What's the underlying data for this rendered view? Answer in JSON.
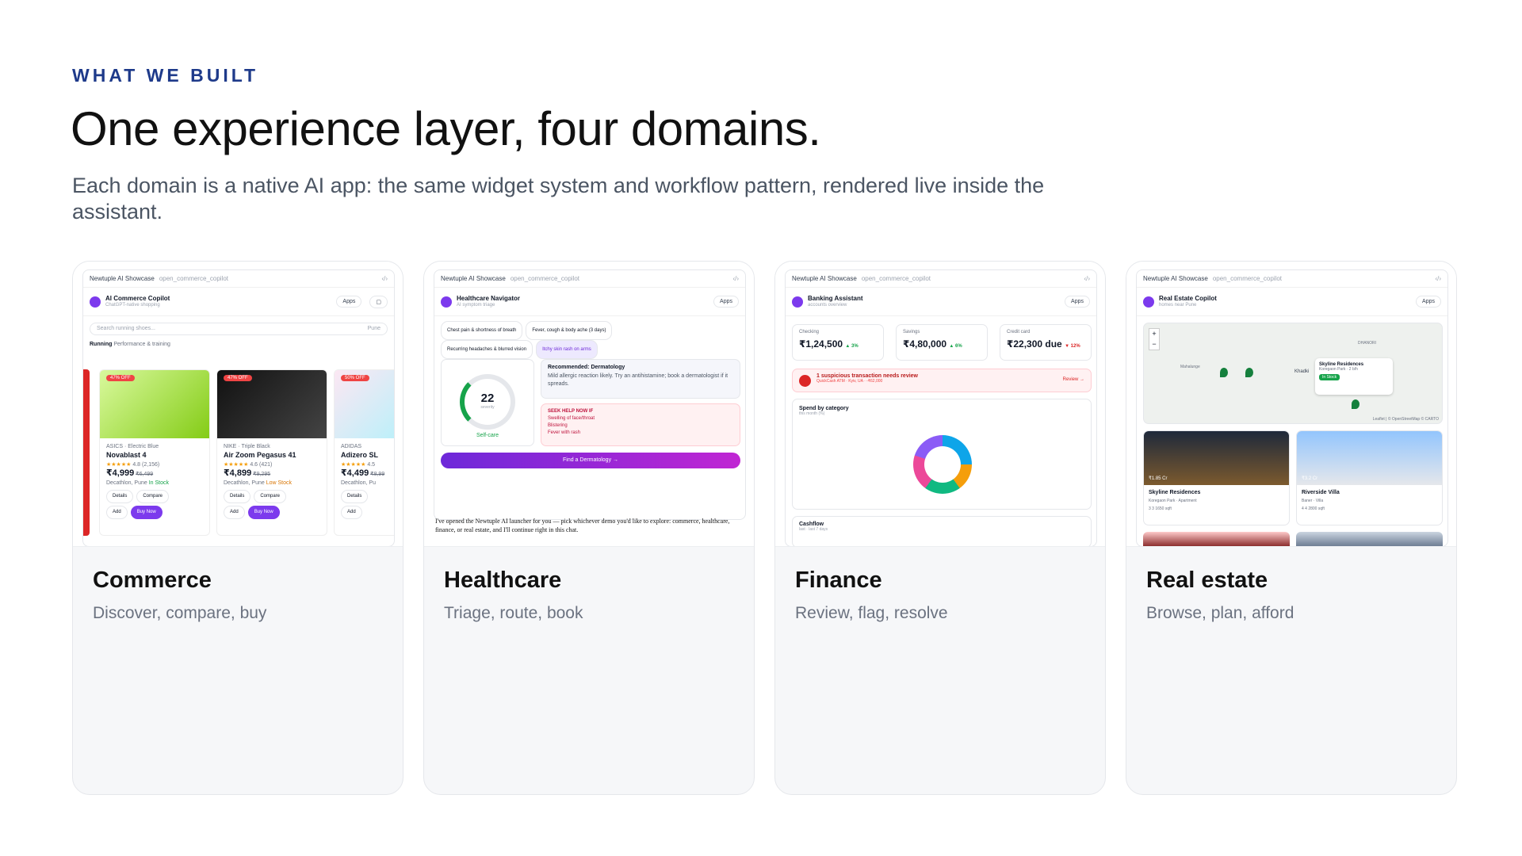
{
  "header": {
    "eyebrow": "WHAT WE BUILT",
    "title": "One experience layer, four domains.",
    "subtitle": "Each domain is a native AI app: the same widget system and workflow pattern, rendered live inside the assistant."
  },
  "colors": {
    "accent": "#1e3a8a",
    "brand": "#7c3aed",
    "card_bg": "#f6f7f9"
  },
  "cards": [
    {
      "title": "Commerce",
      "subtitle": "Discover, compare, buy",
      "screenshot": {
        "topbar": "Newtuple AI Showcase",
        "topbar_muted": "open_commerce_copilot",
        "app_name": "AI Commerce Copilot",
        "app_sub": "ChatGPT-native shopping",
        "apps_label": "Apps",
        "search_placeholder": "Search running shoes...",
        "location": "Pune",
        "section": "Running",
        "section_sub": "Performance & training",
        "products": [
          {
            "tag": "47% OFF",
            "brand": "ASICS",
            "variant": "Electric Blue",
            "name": "Novablast 4",
            "rating": "4.8 (2,156)",
            "price": "₹4,999",
            "old": "₹6,499",
            "store": "Decathlon, Pune",
            "stock": "In Stock"
          },
          {
            "tag": "47% OFF",
            "brand": "NIKE",
            "variant": "Triple Black",
            "name": "Air Zoom Pegasus 41",
            "rating": "4.6 (421)",
            "price": "₹4,899",
            "old": "₹9,295",
            "store": "Decathlon, Pune",
            "stock": "Low Stock"
          },
          {
            "tag": "50% OFF",
            "brand": "ADIDAS",
            "variant": "",
            "name": "Adizero SL",
            "rating": "4.5",
            "price": "₹4,499",
            "old": "₹8,99",
            "store": "Decathlon, Pu",
            "stock": ""
          }
        ],
        "btn_details": "Details",
        "btn_compare": "Compare",
        "btn_add": "Add",
        "btn_buy": "Buy Now"
      }
    },
    {
      "title": "Healthcare",
      "subtitle": "Triage, route, book",
      "screenshot": {
        "topbar": "Newtuple AI Showcase",
        "topbar_muted": "open_commerce_copilot",
        "app_name": "Healthcare Navigator",
        "app_sub": "AI symptom triage",
        "apps_label": "Apps",
        "chips": [
          "Chest pain & shortness of breath",
          "Fever, cough & body ache (3 days)",
          "Recurring headaches & blurred vision",
          "Itchy skin rash on arms"
        ],
        "gauge_value": "22",
        "gauge_caption": "severity",
        "gauge_label": "Self-care",
        "rec_title": "Recommended: Dermatology",
        "rec_text": "Mild allergic reaction likely. Try an antihistamine; book a dermatologist if it spreads.",
        "warn_title": "SEEK HELP NOW IF",
        "warn_items": [
          "Swelling of face/throat",
          "Blistering",
          "Fever with rash"
        ],
        "cta": "Find a Dermatology →",
        "chat_text": "I've opened the Newtuple AI launcher for you — pick whichever demo you'd like to explore: commerce, healthcare, finance, or real estate, and I'll continue right in this chat."
      }
    },
    {
      "title": "Finance",
      "subtitle": "Review, flag, resolve",
      "screenshot": {
        "topbar": "Newtuple AI Showcase",
        "topbar_muted": "open_commerce_copilot",
        "app_name": "Banking Assistant",
        "app_sub": "accounts overview",
        "apps_label": "Apps",
        "kpis": [
          {
            "label": "Checking",
            "value": "₹1,24,500",
            "delta": "▲ 3%"
          },
          {
            "label": "Savings",
            "value": "₹4,80,000",
            "delta": "▲ 6%"
          },
          {
            "label": "Credit card",
            "value": "₹22,300 due",
            "delta": "▼ 12%"
          }
        ],
        "alert_title": "1 suspicious transaction needs review",
        "alert_sub": "QuickCash ATM · Kyiv, UA · -₹62,000",
        "alert_action": "Review →",
        "spend_title": "Spend by category",
        "spend_sub": "this month (%)",
        "cashflow_title": "Cashflow",
        "cashflow_sub": "last · last 7 days"
      }
    },
    {
      "title": "Real estate",
      "subtitle": "Browse, plan, afford",
      "screenshot": {
        "topbar": "Newtuple AI Showcase",
        "topbar_muted": "open_commerce_copilot",
        "app_name": "Real Estate Copilot",
        "app_sub": "homes near Pune",
        "apps_label": "Apps",
        "map_labels": [
          "Mahalunge",
          "Khadki",
          "DHANORI"
        ],
        "popup_title": "Skyline Residences",
        "popup_sub": "Koregaon Park · 2 b/h",
        "popup_badge": "In Stock",
        "map_credit": "Leaflet | © OpenStreetMap © CARTO",
        "listings": [
          {
            "price": "₹1.85 Cr",
            "name": "Skyline Residences",
            "loc": "Koregaon Park · Apartment",
            "specs": "3  3  1650 sqft"
          },
          {
            "price": "₹3.2 Cr",
            "name": "Riverside Villa",
            "loc": "Baner · Villa",
            "specs": "4  4  2800 sqft"
          }
        ]
      }
    }
  ]
}
